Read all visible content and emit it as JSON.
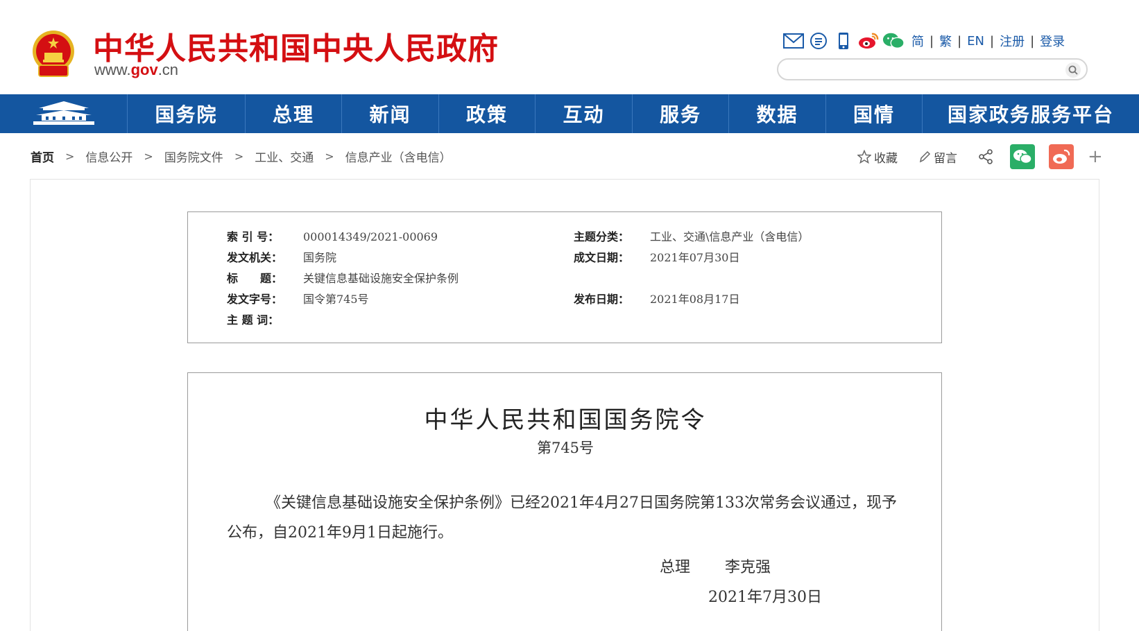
{
  "header": {
    "site_title": "中华人民共和国中央人民政府",
    "site_url_prefix": "www.",
    "site_url_highlight": "gov",
    "site_url_suffix": ".cn",
    "lang_links": [
      "简",
      "繁",
      "EN",
      "注册",
      "登录"
    ],
    "search_placeholder": ""
  },
  "nav": {
    "items": [
      "国务院",
      "总理",
      "新闻",
      "政策",
      "互动",
      "服务",
      "数据",
      "国情",
      "国家政务服务平台"
    ]
  },
  "breadcrumb": [
    "首页",
    "信息公开",
    "国务院文件",
    "工业、交通",
    "信息产业（含电信）"
  ],
  "share": {
    "collect_label": "收藏",
    "comment_label": "留言"
  },
  "meta": {
    "index_label": "索 引 号：",
    "index_value": "000014349/2021-00069",
    "topic_label": "主题分类：",
    "topic_value": "工业、交通\\信息产业（含电信）",
    "issuer_label": "发文机关：",
    "issuer_value": "国务院",
    "written_date_label": "成文日期：",
    "written_date_value": "2021年07月30日",
    "title_label": "标　　题：",
    "title_value": "关键信息基础设施安全保护条例",
    "doc_number_label": "发文字号：",
    "doc_number_value": "国令第745号",
    "publish_date_label": "发布日期：",
    "publish_date_value": "2021年08月17日",
    "keywords_label": "主 题 词："
  },
  "document": {
    "title": "中华人民共和国国务院令",
    "number": "第745号",
    "body": "《关键信息基础设施安全保护条例》已经2021年4月27日国务院第133次常务会议通过，现予公布，自2021年9月1日起施行。",
    "sign_role": "总理",
    "sign_name": "李克强",
    "date": "2021年7月30日"
  },
  "colors": {
    "brand_red": "#d40f12",
    "nav_blue": "#1456a0",
    "link_blue": "#1a5aa8"
  }
}
